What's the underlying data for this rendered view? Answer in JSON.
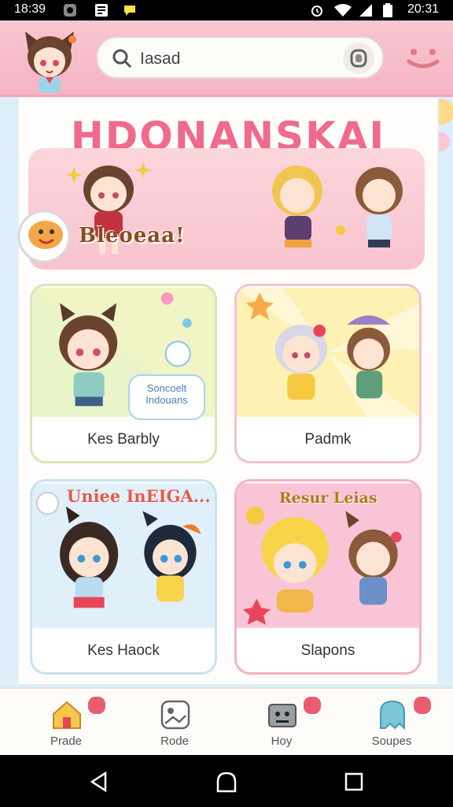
{
  "status_bar": {
    "time_left": "18:39",
    "time_right": "20:31"
  },
  "search": {
    "value": "Iasad"
  },
  "title": "HDONANSKAI",
  "banner": {
    "label": "Bleoeaa!"
  },
  "cards": [
    {
      "label": "Kes   Barbly"
    },
    {
      "label": "Padmk"
    },
    {
      "label": "Kes   Haock",
      "caption": "Uniee InEIGA..."
    },
    {
      "label": "Slapons",
      "caption": "Resur Leias"
    }
  ],
  "bubble": {
    "line1": "Soncoelt",
    "line2": "Indouans"
  },
  "bottom_nav": [
    {
      "label": "Prade",
      "icon": "home-icon",
      "badge": true
    },
    {
      "label": "Rode",
      "icon": "gallery-icon",
      "badge": false
    },
    {
      "label": "Hoy",
      "icon": "robot-icon",
      "badge": true
    },
    {
      "label": "Soupes",
      "icon": "ghost-icon",
      "badge": true
    }
  ],
  "colors": {
    "header": "#f6b4c4",
    "accent_pink": "#ec5c70",
    "background": "#dbeefa"
  }
}
